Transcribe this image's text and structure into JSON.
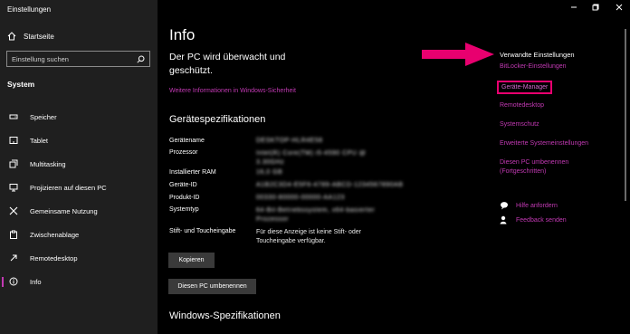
{
  "app": {
    "title": "Einstellungen"
  },
  "sidebar": {
    "home_label": "Startseite",
    "search_placeholder": "Einstellung suchen",
    "section_title": "System",
    "items": [
      {
        "label": "Speicher",
        "icon": "storage-icon"
      },
      {
        "label": "Tablet",
        "icon": "tablet-icon"
      },
      {
        "label": "Multitasking",
        "icon": "multitasking-icon"
      },
      {
        "label": "Projizieren auf diesen PC",
        "icon": "project-icon"
      },
      {
        "label": "Gemeinsame Nutzung",
        "icon": "shared-experiences-icon"
      },
      {
        "label": "Zwischenablage",
        "icon": "clipboard-icon"
      },
      {
        "label": "Remotedesktop",
        "icon": "remote-desktop-icon"
      },
      {
        "label": "Info",
        "icon": "info-icon",
        "selected": true
      }
    ]
  },
  "main": {
    "page_title": "Info",
    "security_status": "Der PC wird überwacht und geschützt.",
    "security_link": "Weitere Informationen in Windows-Sicherheit",
    "specs_title": "Gerätespezifikationen",
    "specs": [
      {
        "label": "Gerätename",
        "value": "DESKTOP-HLR4E58"
      },
      {
        "label": "Prozessor",
        "value": "Intel(R) Core(TM) i5-4590 CPU @ 3.30GHz"
      },
      {
        "label": "Installierter RAM",
        "value": "16,0 GB"
      },
      {
        "label": "Geräte-ID",
        "value": "A1B2C3D4-E5F6-4789-ABCD-1234567890AB"
      },
      {
        "label": "Produkt-ID",
        "value": "00330-80000-00000-AA123"
      },
      {
        "label": "Systemtyp",
        "value": "64-Bit-Betriebssystem, x64-basierter Prozessor"
      },
      {
        "label": "Stift- und Toucheingabe",
        "value": "Für diese Anzeige ist keine Stift- oder Toucheingabe verfügbar."
      }
    ],
    "copy_button": "Kopieren",
    "rename_button": "Diesen PC umbenennen",
    "windows_specs_title": "Windows-Spezifikationen"
  },
  "related": {
    "title": "Verwandte Einstellungen",
    "links": [
      "BitLocker-Einstellungen",
      "Geräte-Manager",
      "Remotedesktop",
      "Systemschutz",
      "Erweiterte Systemeinstellungen",
      "Diesen PC umbenennen (Fortgeschritten)"
    ],
    "help_link": "Hilfe anfordern",
    "feedback_link": "Feedback senden"
  },
  "colors": {
    "accent": "#c239b3",
    "highlight": "#e8006f",
    "sidebar_bg": "#1f1f1f",
    "main_bg": "#000000"
  }
}
